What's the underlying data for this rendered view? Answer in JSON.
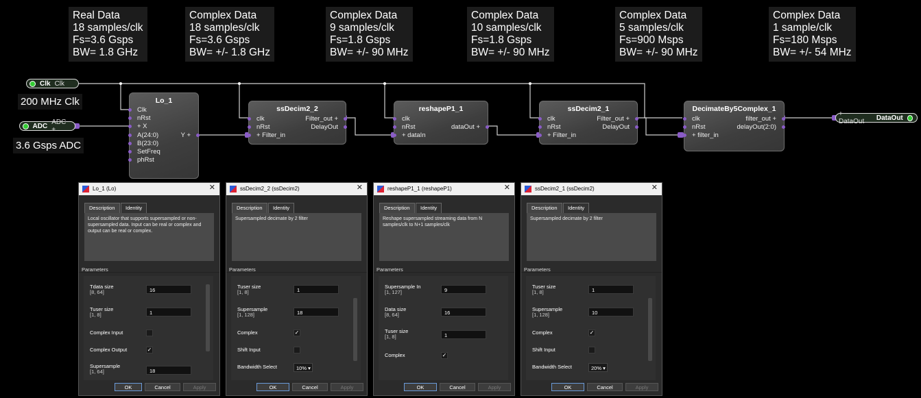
{
  "info_boxes": [
    {
      "text": "Real Data\n18 samples/clk\nFs=3.6 Gsps\nBW= 1.8 GHz"
    },
    {
      "text": "Complex Data\n18 samples/clk\nFs=3.6 Gsps\nBW= +/- 1.8 GHz"
    },
    {
      "text": "Complex Data\n9 samples/clk\nFs=1.8 Gsps\nBW= +/- 90 MHz"
    },
    {
      "text": "Complex Data\n10 samples/clk\nFs=1.8 Gsps\nBW= +/- 90 MHz"
    },
    {
      "text": "Complex Data\n5 samples/clk\nFs=900 Msps\nBW= +/- 90 MHz"
    },
    {
      "text": "Complex Data\n1 sample/clk\nFs=180 Msps\nBW= +/- 54 MHz"
    }
  ],
  "inputs": {
    "clk": {
      "label": "Clk",
      "sub": "Clk",
      "note": "200 MHz Clk"
    },
    "adc": {
      "label": "ADC",
      "sub": "ADC +",
      "note": "3.6 Gsps ADC"
    }
  },
  "output": {
    "sub": "+ DataOut",
    "label": "DataOut"
  },
  "blocks": [
    {
      "title": "Lo_1",
      "inputs": [
        "Clk",
        "nRst",
        "+ X",
        "A(24:0)",
        "B(23:0)",
        "SetFreq",
        "phRst"
      ],
      "outputs": [
        "Y +"
      ]
    },
    {
      "title": "ssDecim2_2",
      "inputs": [
        "clk",
        "nRst",
        "+ Filter_in"
      ],
      "outputs": [
        "Filter_out +",
        "DelayOut"
      ]
    },
    {
      "title": "reshapeP1_1",
      "inputs": [
        "clk",
        "nRst",
        "+ dataIn"
      ],
      "outputs": [
        "dataOut +"
      ]
    },
    {
      "title": "ssDecim2_1",
      "inputs": [
        "clk",
        "nRst",
        "+ Filter_in"
      ],
      "outputs": [
        "Filter_out +",
        "DelayOut"
      ]
    },
    {
      "title": "DecimateBy5Complex_1",
      "inputs": [
        "clk",
        "nRst",
        "+ filter_in"
      ],
      "outputs": [
        "filter_out +",
        "delayOut(2:0)"
      ]
    }
  ],
  "dialogs": [
    {
      "title": "Lo_1 (Lo)",
      "tabs": [
        "Description",
        "Identity"
      ],
      "description": "Local oscillator that supports supersampled or non-supersampled data.  Input can be real or complex and output can be real or complex.",
      "section": "Parameters",
      "params": [
        {
          "label": "Tdata size",
          "range": "[8, 64]",
          "kind": "field",
          "value": "16"
        },
        {
          "label": "Tuser size",
          "range": "[1, 8]",
          "kind": "field",
          "value": "1"
        },
        {
          "label": "Complex Input",
          "range": "",
          "kind": "check",
          "value": ""
        },
        {
          "label": "Complex Output",
          "range": "",
          "kind": "check",
          "value": "✓"
        },
        {
          "label": "Supersample",
          "range": "[1, 64]",
          "kind": "field",
          "value": "18"
        }
      ],
      "buttons": [
        "OK",
        "Cancel",
        "Apply"
      ]
    },
    {
      "title": "ssDecim2_2 (ssDecim2)",
      "tabs": [
        "Description",
        "Identity"
      ],
      "description": "Supersampled decimate by 2 filter",
      "section": "Parameters",
      "params": [
        {
          "label": "Tuser size",
          "range": "[1, 8]",
          "kind": "field",
          "value": "1"
        },
        {
          "label": "Supersample",
          "range": "[1, 128]",
          "kind": "field",
          "value": "18"
        },
        {
          "label": "Complex",
          "range": "",
          "kind": "check",
          "value": "✓"
        },
        {
          "label": "Shift Input",
          "range": "",
          "kind": "check",
          "value": ""
        },
        {
          "label": "Bandwidth Select",
          "range": "",
          "kind": "dropdown",
          "value": "10% ▾"
        }
      ],
      "buttons": [
        "OK",
        "Cancel",
        "Apply"
      ]
    },
    {
      "title": "reshapeP1_1 (reshapeP1)",
      "tabs": [
        "Description",
        "Identity"
      ],
      "description": "Reshape supersampled streaming data from N samples/clk to N+1 samples/clk",
      "section": "Parameters",
      "params": [
        {
          "label": "Supersample In",
          "range": "[1, 127]",
          "kind": "field",
          "value": "9"
        },
        {
          "label": "Data size",
          "range": "[8, 64]",
          "kind": "field",
          "value": "16"
        },
        {
          "label": "Tuser size",
          "range": "[1, 8]",
          "kind": "field",
          "value": "1"
        },
        {
          "label": "Complex",
          "range": "",
          "kind": "check",
          "value": "✓"
        }
      ],
      "buttons": [
        "OK",
        "Cancel",
        "Apply"
      ]
    },
    {
      "title": "ssDecim2_1 (ssDecim2)",
      "tabs": [
        "Description",
        "Identity"
      ],
      "description": "Supersampled decimate by 2 filter",
      "section": "Parameters",
      "params": [
        {
          "label": "Tuser size",
          "range": "[1, 8]",
          "kind": "field",
          "value": "1"
        },
        {
          "label": "Supersample",
          "range": "[1, 128]",
          "kind": "field",
          "value": "10"
        },
        {
          "label": "Complex",
          "range": "",
          "kind": "check",
          "value": "✓"
        },
        {
          "label": "Shift Input",
          "range": "",
          "kind": "check",
          "value": ""
        },
        {
          "label": "Bandwidth Select",
          "range": "",
          "kind": "dropdown",
          "value": "20% ▾"
        }
      ],
      "buttons": [
        "OK",
        "Cancel",
        "Apply"
      ]
    }
  ]
}
